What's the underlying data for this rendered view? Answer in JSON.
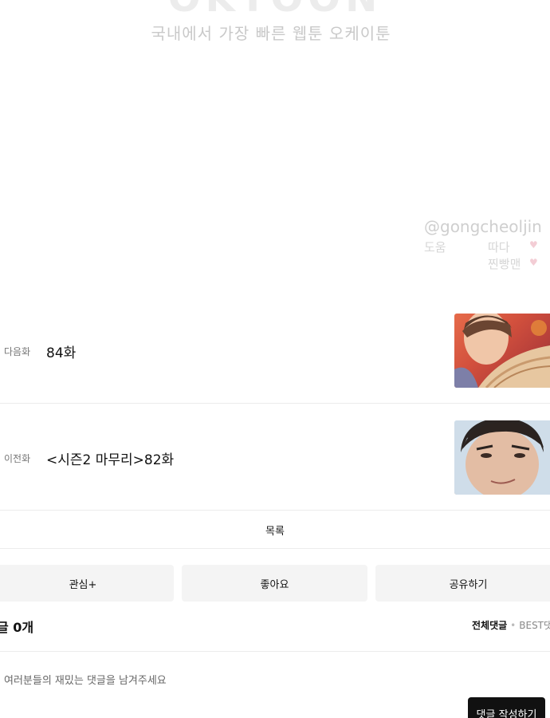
{
  "watermark": {
    "logo": "OKTOON",
    "tagline": "국내에서 가장 빠른 웹툰 오케이툰",
    "handle": "@gongcheoljin",
    "help_label": "도움",
    "name_1": "따다",
    "name_2": "찐빵맨"
  },
  "episode_nav": {
    "next": {
      "tag": "다음화",
      "title": "84화"
    },
    "prev": {
      "tag": "이전화",
      "title": "<시즌2 마무리>82화"
    }
  },
  "list_label": "목록",
  "actions": {
    "subscribe": "관심+",
    "like": "좋아요",
    "share": "공유하기"
  },
  "comments": {
    "count_label": "글 0개",
    "tab_all": "전체댓글",
    "tab_separator": "•",
    "tab_best": "BEST댓",
    "placeholder": "여러분들의 재밌는 댓글을 남겨주세요",
    "write_button": "댓글 작성하기"
  },
  "colors": {
    "accent_button": "#111111",
    "action_bg": "#f4f4f4",
    "divider": "#ececec"
  }
}
